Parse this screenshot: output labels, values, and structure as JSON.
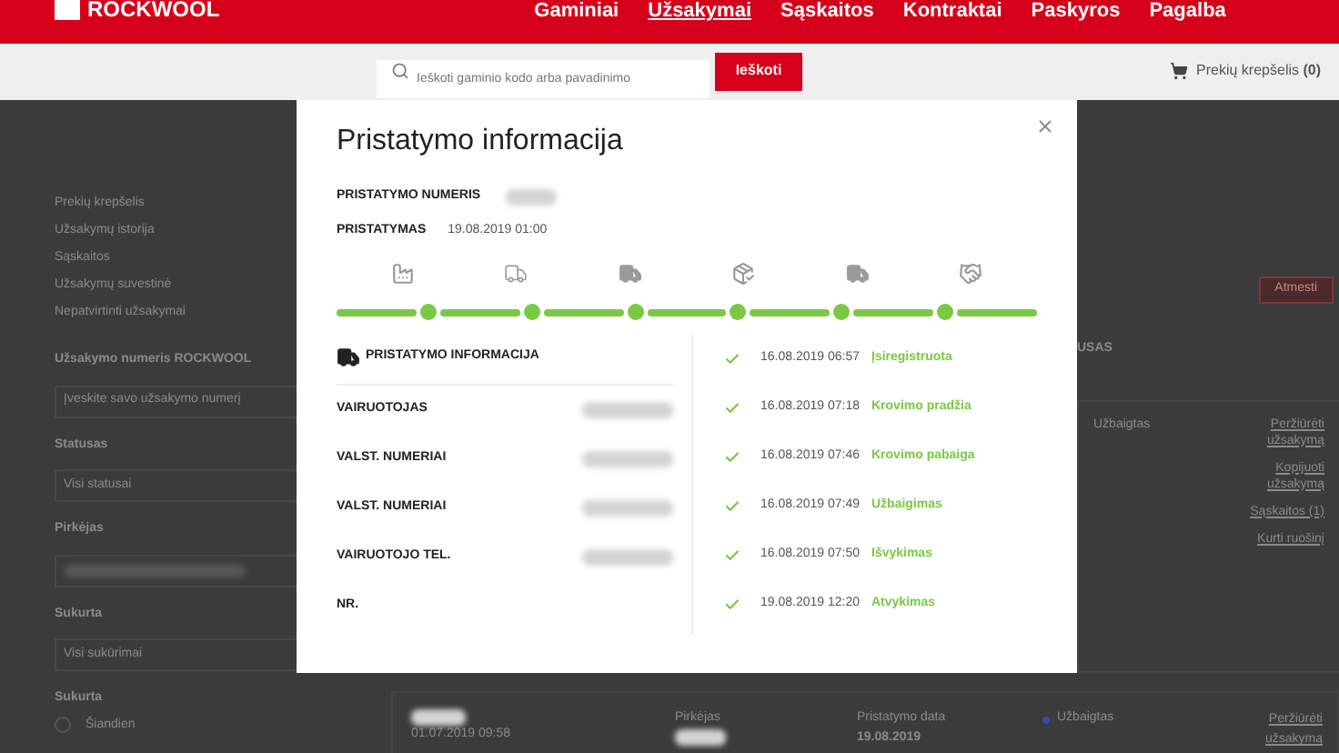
{
  "header": {
    "logo": "ROCKWOOL",
    "nav": [
      {
        "label": "Gaminiai",
        "selected": false
      },
      {
        "label": "Užsakymai",
        "selected": true
      },
      {
        "label": "Sąskaitos",
        "selected": false
      },
      {
        "label": "Kontraktai",
        "selected": false
      },
      {
        "label": "Paskyros",
        "selected": false
      },
      {
        "label": "Pagalba",
        "selected": false
      }
    ],
    "search": {
      "placeholder": "Ieškoti gaminio kodo arba pavadinimo",
      "button": "Ieškoti"
    },
    "cart": "Prekių krepšelis **(0)**"
  },
  "sidebar": {
    "links": [
      "Prekių krepšelis",
      "Užsakymų istorija",
      "Sąskaitos",
      "Užsakymų suvestinė",
      "Nepatvirtinti užsakymai"
    ],
    "filters": [
      {
        "kind": "input",
        "label": "Užsakymo numeris ROCKWOOL",
        "placeholder": "Įveskite savo užsakymo numerį"
      },
      {
        "kind": "select",
        "label": "Statusas",
        "value": "Visi statusai"
      },
      {
        "kind": "select",
        "label": "Pirkėjas",
        "blurred": true
      },
      {
        "kind": "select",
        "label": "Sukurta",
        "value": "Visi sukūrimai"
      },
      {
        "kind": "radio",
        "label": "Sukurta",
        "option": "Šiandien",
        "checked": false
      }
    ]
  },
  "orders": {
    "reject_button": "Atmesti",
    "heading_fragment": "USAS",
    "card": {
      "status": "Užbaigtas",
      "actions": [
        "Peržiūrėti užsakymą",
        "Kopijuoti užsakymą",
        "Sąskaitos (1)",
        "Kurti ruošinį"
      ]
    },
    "next_card": {
      "date": "01.07.2019 09:58",
      "buyer_label": "Pirkėjas",
      "delivery_label": "Pristatymo data",
      "delivery_date": "19.08.2019",
      "status": "Užbaigtas",
      "action": "Peržiūrėti užsakymą"
    }
  },
  "modal": {
    "title": "Pristatymo informacija",
    "number_label": "PRISTATYMO NUMERIS",
    "date_label": "PRISTATYMAS",
    "date_value": "19.08.2019 01:00",
    "timeline": [
      {
        "kind": "factory",
        "done": true
      },
      {
        "kind": "truck-outline",
        "done": true
      },
      {
        "kind": "truck",
        "done": true
      },
      {
        "kind": "truck-check",
        "done": true
      },
      {
        "kind": "truck",
        "done": true
      },
      {
        "kind": "handshake",
        "done": true
      }
    ],
    "info_title": "PRISTATYMO INFORMACIJA",
    "info_rows": [
      {
        "label": "VAIRUOTOJAS",
        "blurred": true
      },
      {
        "label": "VALST. NUMERIAI",
        "blurred": true
      },
      {
        "label": "VALST. NUMERIAI",
        "blurred": true
      },
      {
        "label": "VAIRUOTOJO TEL.",
        "blurred": true
      },
      {
        "label": "NR.",
        "blurred": false
      }
    ],
    "events": [
      {
        "date": "16.08.2019 06:57",
        "label": "Įsiregistruota",
        "done": true
      },
      {
        "date": "16.08.2019 07:18",
        "label": "Krovimo pradžia",
        "done": true
      },
      {
        "date": "16.08.2019 07:46",
        "label": "Krovimo pabaiga",
        "done": true
      },
      {
        "date": "16.08.2019 07:49",
        "label": "Užbaigimas",
        "done": true
      },
      {
        "date": "16.08.2019 07:50",
        "label": "Išvykimas",
        "done": true
      },
      {
        "date": "19.08.2019 12:20",
        "label": "Atvykimas",
        "done": true
      }
    ]
  }
}
